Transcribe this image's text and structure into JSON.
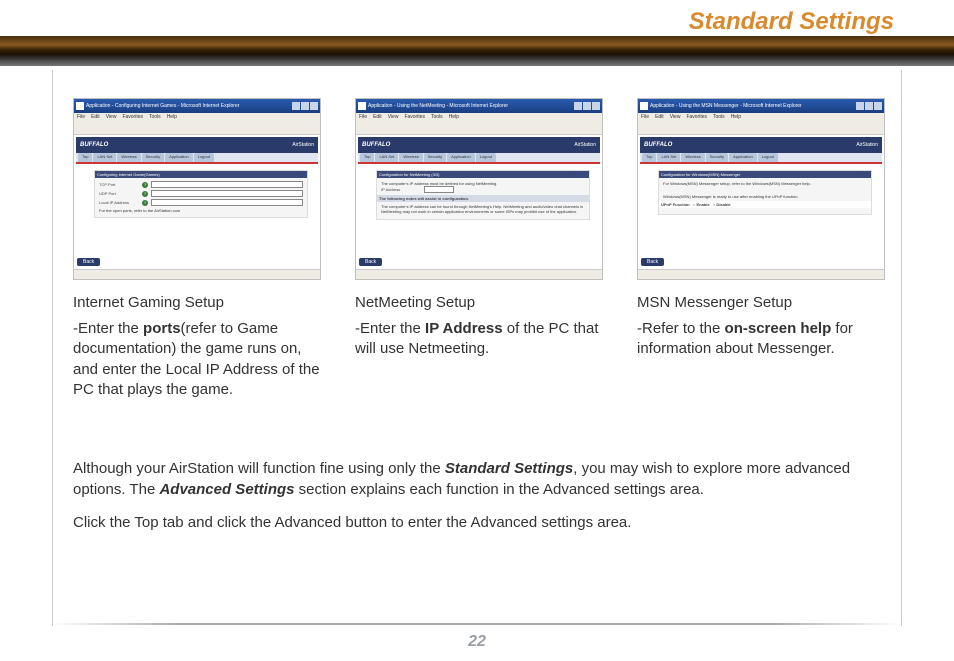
{
  "page": {
    "title": "Standard Settings",
    "number": "22"
  },
  "thumbs": {
    "menubar_items": [
      "File",
      "Edit",
      "View",
      "Favorites",
      "Tools",
      "Help"
    ],
    "brand_left": "BUFFALO",
    "brand_right": "AirStation",
    "tabs": [
      "Top",
      "LAN Set",
      "Wireless",
      "Security",
      "Application",
      "Logout"
    ],
    "back_label": "Back",
    "panel1_head": "Configuring Internet Game(Games)",
    "panel2_head": "Configuration for NetMeeting (3/3)",
    "panel3_head": "Configuration for Windows(MSN) Messenger"
  },
  "columns": [
    {
      "title": "Internet Gaming Setup",
      "desc_pre": "-Enter the ",
      "desc_bold": "ports",
      "desc_post": "(refer to Game documentation) the game runs on, and enter the Local IP Address of the PC that plays the game."
    },
    {
      "title": "NetMeeting Setup",
      "desc_pre": "-Enter the ",
      "desc_bold": "IP Address",
      "desc_post": " of the PC that will use Netmeeting."
    },
    {
      "title": "MSN Messenger Setup",
      "desc_pre": "-Refer to the ",
      "desc_bold": "on-screen help",
      "desc_post": " for information about Messenger."
    }
  ],
  "paragraphs": {
    "p1_pre": "Although your AirStation will function fine using only the ",
    "p1_b1": "Standard Settings",
    "p1_mid": ", you may wish to explore more advanced options.  The ",
    "p1_b2": "Advanced Settings",
    "p1_post": " section explains each function in the Advanced settings area.",
    "p2": "Click the Top tab and click the Advanced button to enter the Advanced settings area."
  }
}
